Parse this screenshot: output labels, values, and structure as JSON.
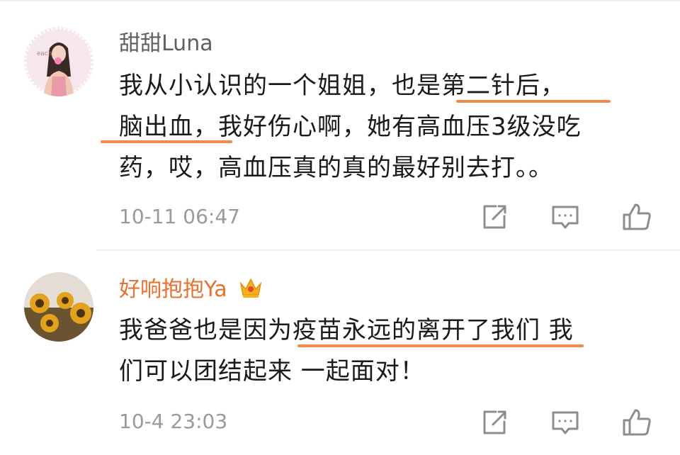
{
  "comments": [
    {
      "username": "甜甜Luna",
      "lines": [
        "我从小认识的一个姐姐，也是第二针后，",
        "脑出血，我好伤心啊，她有高血压3级没吃",
        "药，哎，高血压真的真的最好别去打。。"
      ],
      "time": "10-11 06:47",
      "avatar_icon": "woman-portrait-avatar"
    },
    {
      "username": "好响抱抱Ya",
      "lines": [
        "我爸爸也是因为疫苗永远的离开了我们 我",
        "们可以团结起来 一起面对！"
      ],
      "time": "10-4 23:03",
      "badge_icon": "crown-icon",
      "avatar_icon": "sunflower-avatar"
    }
  ],
  "colors": {
    "username_default": "#5f5f5f",
    "username_vip": "#e9702d",
    "highlight_underline": "#f08a4b",
    "timestamp": "#9a9a9a"
  }
}
